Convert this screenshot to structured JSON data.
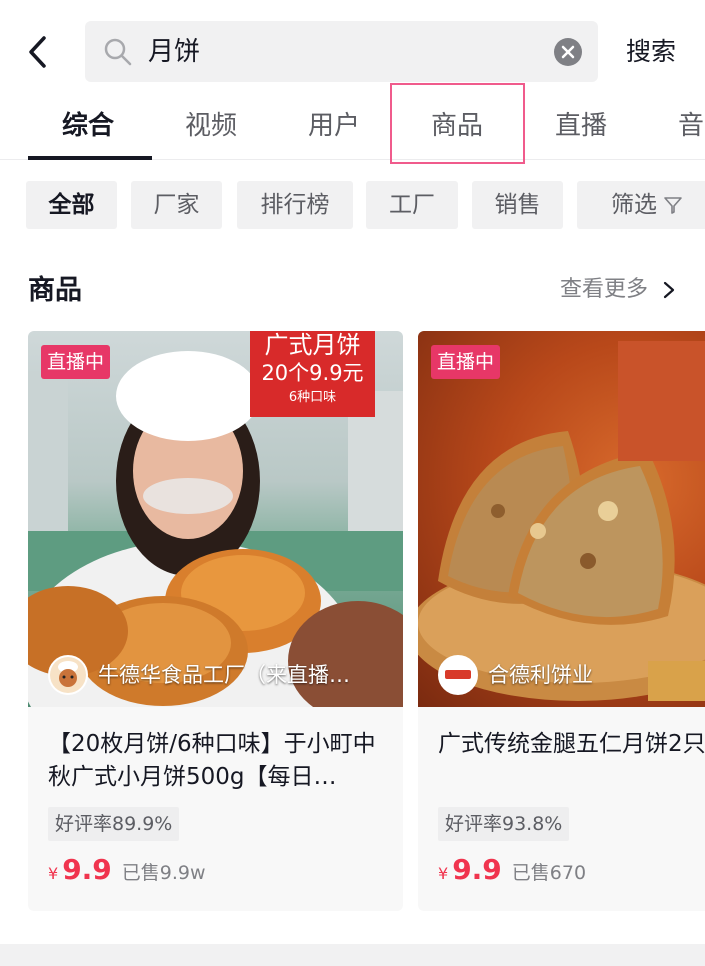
{
  "search": {
    "query": "月饼",
    "submit_label": "搜索"
  },
  "tabs": [
    {
      "label": "综合",
      "active": true
    },
    {
      "label": "视频",
      "active": false
    },
    {
      "label": "用户",
      "active": false
    },
    {
      "label": "商品",
      "active": false
    },
    {
      "label": "直播",
      "active": false
    },
    {
      "label": "音",
      "active": false
    }
  ],
  "filters": {
    "chips": [
      "全部",
      "厂家",
      "排行榜",
      "工厂",
      "销售"
    ],
    "filter_label": "筛选"
  },
  "section": {
    "title": "商品",
    "see_more": "查看更多"
  },
  "products": [
    {
      "badge": "直播中",
      "promo_lines": [
        "广式月饼",
        "20个9.9元",
        "6种口味"
      ],
      "shop_name": "牛德华食品工厂（来直播…",
      "title": "【20枚月饼/6种口味】于小町中秋广式小月饼500g【每日…",
      "rating": "好评率89.9%",
      "currency": "¥",
      "price": "9.9",
      "sold": "已售9.9w"
    },
    {
      "badge": "直播中",
      "shop_name": "合德利饼业",
      "title": "广式传统金腿五仁月饼2只",
      "rating": "好评率93.8%",
      "currency": "¥",
      "price": "9.9",
      "sold": "已售670"
    }
  ],
  "colors": {
    "accent": "#f0344e",
    "live_badge": "#e73767",
    "highlight_box": "#f05b8c"
  }
}
